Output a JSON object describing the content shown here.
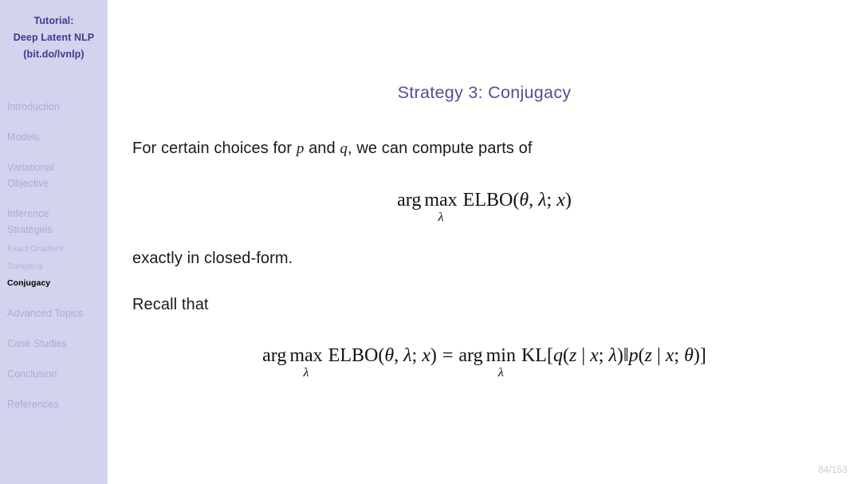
{
  "sidebar": {
    "title_lines": [
      "Tutorial:",
      "Deep Latent NLP",
      "(bit.do/lvnlp)"
    ],
    "sections": [
      {
        "label": "Introduction",
        "lines": [
          "Introduction"
        ]
      },
      {
        "label": "Models",
        "lines": [
          "Models"
        ]
      },
      {
        "label": "Variational Objective",
        "lines": [
          "Variational",
          "Objective"
        ]
      },
      {
        "label": "Inference Strategies",
        "lines": [
          "Inference",
          "Strategies"
        ]
      },
      {
        "label": "Advanced Topics",
        "lines": [
          "Advanced Topics"
        ]
      },
      {
        "label": "Case Studies",
        "lines": [
          "Case Studies"
        ]
      },
      {
        "label": "Conclusion",
        "lines": [
          "Conclusion"
        ]
      },
      {
        "label": "References",
        "lines": [
          "References"
        ]
      }
    ],
    "subitems": [
      {
        "label": "Exact Gradient",
        "active": false
      },
      {
        "label": "Sampling",
        "active": false
      },
      {
        "label": "Conjugacy",
        "active": true
      }
    ],
    "colors": {
      "background": "#d3d3ee",
      "title_text": "#3b3b8f",
      "inactive_text": "#aaaad8",
      "active_text": "#000000"
    }
  },
  "slide": {
    "title": "Strategy 3: Conjugacy",
    "title_color": "#4f4f9a",
    "background": "#fffffd",
    "body": {
      "line_1_part_a": "For certain choices for ",
      "line_1_math_p": "p",
      "line_1_part_b": " and ",
      "line_1_math_q": "q",
      "line_1_part_c": ", we can compute parts of",
      "line_2": "exactly in closed-form.",
      "line_3": "Recall that"
    },
    "equations": {
      "eq1": {
        "plain": "arg max_λ ELBO(θ, λ; x)",
        "arg": "arg",
        "op": "max",
        "op_sub": "λ",
        "rest": "ELBO(θ, λ; x)",
        "func_name": "ELBO",
        "open_paren": "(",
        "theta": "θ",
        "comma": ", ",
        "lambda": "λ",
        "semicolon": "; ",
        "x": "x",
        "close_paren": ")"
      },
      "eq2": {
        "plain": "arg max_λ ELBO(θ, λ; x) = arg min_λ KL[q(z | x; λ)‖p(z | x; θ)]",
        "lhs_arg": "arg",
        "lhs_op": "max",
        "lhs_op_sub": "λ",
        "lhs_func": "ELBO",
        "lhs_body": "(θ, λ; x)",
        "equals": "=",
        "rhs_arg": "arg",
        "rhs_op": "min",
        "rhs_op_sub": "λ",
        "rhs_func": "KL",
        "open_bracket": "[",
        "q": "q",
        "q_body_open": "(",
        "z": "z",
        "mid": " | ",
        "x": "x",
        "semi": "; ",
        "lambda": "λ",
        "q_body_close": ")",
        "norm_bar": "‖",
        "p": "p",
        "theta": "θ",
        "close_bracket": "]"
      }
    }
  },
  "footer": {
    "page_number": "84/153",
    "color": "#c8c8e2"
  }
}
